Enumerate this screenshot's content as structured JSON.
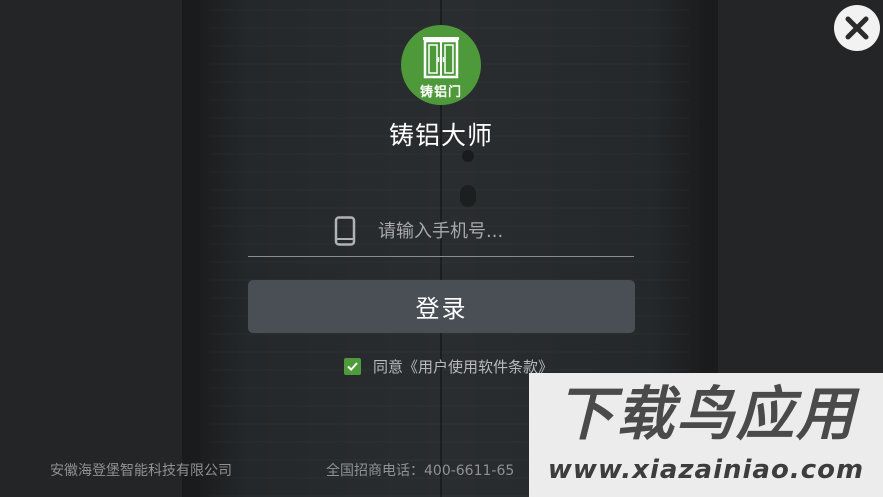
{
  "logo": {
    "text": "铸铝门",
    "icon": "door-icon",
    "color": "#4e9a3a"
  },
  "app_name": "铸铝大师",
  "phone": {
    "icon": "phone-icon",
    "placeholder": "请输入手机号...",
    "value": ""
  },
  "login_button": "登录",
  "agreement": {
    "checked": true,
    "text": "同意《用户使用软件条款》",
    "check_color": "#4f9a3a"
  },
  "footer": {
    "company": "安徽海登堡智能科技有限公司",
    "hotline": "全国招商电话：400-6611-65"
  },
  "close_icon": "close-icon",
  "watermark": {
    "title": "下载鸟应用",
    "url": "www.xiazainiao.com"
  }
}
